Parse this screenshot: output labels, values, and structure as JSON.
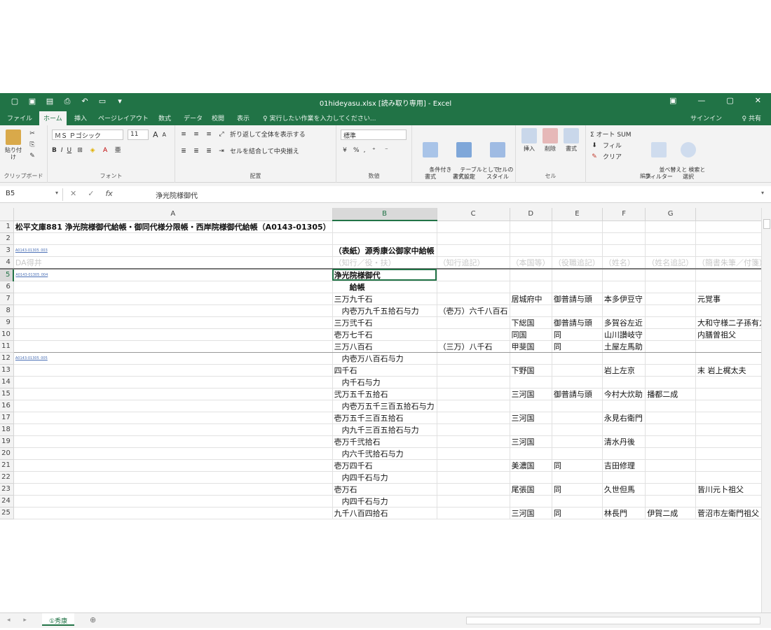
{
  "window": {
    "title": "01hideyasu.xlsx [読み取り専用] - Excel",
    "qat": [
      "▢",
      "▣",
      "▤",
      "⎙",
      "↶",
      "▭",
      "▾"
    ],
    "controls": [
      "▣",
      "—",
      "▢",
      "✕"
    ]
  },
  "tabs": [
    "ファイル",
    "ホーム",
    "挿入",
    "ページレイアウト",
    "数式",
    "データ",
    "校閲",
    "表示"
  ],
  "tell_me": "♀ 実行したい作業を入力してください...",
  "signin": "サインイン",
  "share": "♀ 共有",
  "ribbon": {
    "clipboard": {
      "label": "クリップボード",
      "paste": "貼り付け"
    },
    "font": {
      "label": "フォント",
      "font_name": "ＭＳ Ｐゴシック",
      "font_size": "11",
      "grow": "A",
      "shrink": "A",
      "bold": "B",
      "italic": "I",
      "underline": "U"
    },
    "alignment": {
      "label": "配置",
      "wrap": "折り返して全体を表示する",
      "merge": "セルを結合して中央揃え"
    },
    "number": {
      "label": "数値",
      "format": "標準",
      "percent": "%",
      "comma": ","
    },
    "styles": {
      "label": "スタイル",
      "conditional": "条件付き\n書式",
      "table": "テーブルとして\n書式設定",
      "cell": "セルの\nスタイル"
    },
    "cells": {
      "label": "セル",
      "insert": "挿入",
      "delete": "削除",
      "format": "書式"
    },
    "editing": {
      "label": "編集",
      "autosum": "Σ オート SUM",
      "fill": "フィル",
      "clear": "クリア",
      "sort": "並べ替えと\nフィルター",
      "find": "検索と\n選択"
    }
  },
  "formula_bar": {
    "name_box": "B5",
    "value": "浄光院様御代",
    "cancel": "✕",
    "enter": "✓",
    "fx": "fx"
  },
  "columns": [
    "A",
    "B",
    "C",
    "D",
    "E",
    "F",
    "G",
    ""
  ],
  "rows": [
    {
      "n": "1",
      "cells": [
        "松平文庫881  浄光院様御代給帳・御同代様分限帳・西岸院様御代給帳（A0143-01305）",
        "",
        "",
        "",
        "",
        "",
        "",
        ""
      ]
    },
    {
      "n": "2",
      "cells": [
        "",
        "",
        "",
        "",
        "",
        "",
        "",
        ""
      ]
    },
    {
      "n": "3",
      "cells": [
        "A0143-01305_003",
        "（表紙）源秀康公御家中給帳",
        "",
        "",
        "",
        "",
        "",
        ""
      ]
    },
    {
      "n": "4",
      "cells": [
        "DA得井",
        "（知行／役・扶）",
        "（知行追記）",
        "（本国等）",
        "（役職追記）",
        "（姓名）",
        "（姓名追記）",
        "（簡書朱筆／付箋）"
      ]
    },
    {
      "n": "5",
      "cells": [
        "A0143-01305_004",
        "浄光院様御代",
        "",
        "",
        "",
        "",
        "",
        ""
      ]
    },
    {
      "n": "6",
      "cells": [
        "",
        "　　給帳",
        "",
        "",
        "",
        "",
        "",
        ""
      ]
    },
    {
      "n": "7",
      "cells": [
        "",
        "三万九千石",
        "",
        "居城府中",
        "御普請与頭",
        "本多伊豆守",
        "",
        "元覚事"
      ]
    },
    {
      "n": "8",
      "cells": [
        "",
        "　内壱万九千五拾石与力",
        "（壱万）六千八百石",
        "",
        "",
        "",
        "",
        ""
      ]
    },
    {
      "n": "9",
      "cells": [
        "",
        "三万弐千石",
        "",
        "下総国",
        "御普請与頭",
        "多賀谷左近",
        "",
        "大和守様二子孫有之"
      ]
    },
    {
      "n": "10",
      "cells": [
        "",
        "壱万七千石",
        "",
        "同国",
        "同",
        "山川讃岐守",
        "",
        "内膳曽祖父"
      ]
    },
    {
      "n": "11",
      "cells": [
        "",
        "三万八百石",
        "（三万）八千石",
        "甲斐国",
        "同",
        "土屋左馬助",
        "",
        ""
      ]
    },
    {
      "n": "12",
      "cells": [
        "A0143-01305_005",
        "　内壱万八百石与力",
        "",
        "",
        "",
        "",
        "",
        ""
      ]
    },
    {
      "n": "13",
      "cells": [
        "",
        "四千石",
        "",
        "下野国",
        "",
        "岩上左京",
        "",
        "末  岩上梶太夫"
      ]
    },
    {
      "n": "14",
      "cells": [
        "",
        "　内千石与力",
        "",
        "",
        "",
        "",
        "",
        ""
      ]
    },
    {
      "n": "15",
      "cells": [
        "",
        "弐万五千五拾石",
        "",
        "三河国",
        "御普請与頭",
        "今村大炊助",
        "播都二成",
        ""
      ]
    },
    {
      "n": "16",
      "cells": [
        "",
        "　内壱万五千三百五拾石与力",
        "",
        "",
        "",
        "",
        "",
        ""
      ]
    },
    {
      "n": "17",
      "cells": [
        "",
        "壱万五千三百五拾石",
        "",
        "三河国",
        "",
        "永見右衛門",
        "",
        ""
      ]
    },
    {
      "n": "18",
      "cells": [
        "",
        "　内九千三百五拾石与力",
        "",
        "",
        "",
        "",
        "",
        ""
      ]
    },
    {
      "n": "19",
      "cells": [
        "",
        "壱万千弐拾石",
        "",
        "三河国",
        "",
        "清水丹後",
        "",
        ""
      ]
    },
    {
      "n": "20",
      "cells": [
        "",
        "　内六千弐拾石与力",
        "",
        "",
        "",
        "",
        "",
        ""
      ]
    },
    {
      "n": "21",
      "cells": [
        "",
        "壱万四千石",
        "",
        "美濃国",
        "同",
        "吉田修理",
        "",
        ""
      ]
    },
    {
      "n": "22",
      "cells": [
        "",
        "　内四千石与力",
        "",
        "",
        "",
        "",
        "",
        ""
      ]
    },
    {
      "n": "23",
      "cells": [
        "",
        "壱万石",
        "",
        "尾張国",
        "同",
        "久世但馬",
        "",
        "皆川元卜祖父"
      ]
    },
    {
      "n": "24",
      "cells": [
        "",
        "　内四千石与力",
        "",
        "",
        "",
        "",
        "",
        ""
      ]
    },
    {
      "n": "25",
      "cells": [
        "",
        "九千八百四拾石",
        "",
        "三河国",
        "同",
        "林長門",
        "伊賀二成",
        "菅沼市左衛門祖父"
      ]
    }
  ],
  "sheet_tab": "①秀康",
  "sheet_nav": "◂ ▸"
}
